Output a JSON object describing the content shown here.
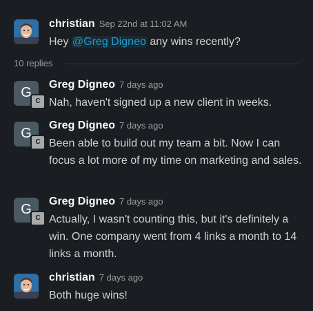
{
  "parent": {
    "author": "christian",
    "time": "Sep 22nd at 11:02 AM",
    "text_before": "Hey ",
    "mention": "@Greg Digneo",
    "text_after": " any wins recently?"
  },
  "replies_label": "10 replies",
  "replies": [
    {
      "author": "Greg Digneo",
      "time": "7 days ago",
      "avatar_initial": "G",
      "badge": "C",
      "text": "Nah, haven't signed up a new client in weeks."
    },
    {
      "author": "Greg Digneo",
      "time": "7 days ago",
      "avatar_initial": "G",
      "badge": "C",
      "text": "Been able to build out my team a bit.  Now I can focus a lot more of my time on marketing and sales."
    },
    {
      "author": "Greg Digneo",
      "time": "7 days ago",
      "avatar_initial": "G",
      "badge": "C",
      "text": "Actually, I wasn't counting this, but it's definitely a win.  One company went from 4 links a month to 14 links a month."
    },
    {
      "author": "christian",
      "time": "7 days ago",
      "text": "Both huge wins!"
    }
  ],
  "colors": {
    "background": "#1a1d21",
    "mention": "#1d9bd1",
    "avatar_initial_bg": "#4a5962"
  }
}
